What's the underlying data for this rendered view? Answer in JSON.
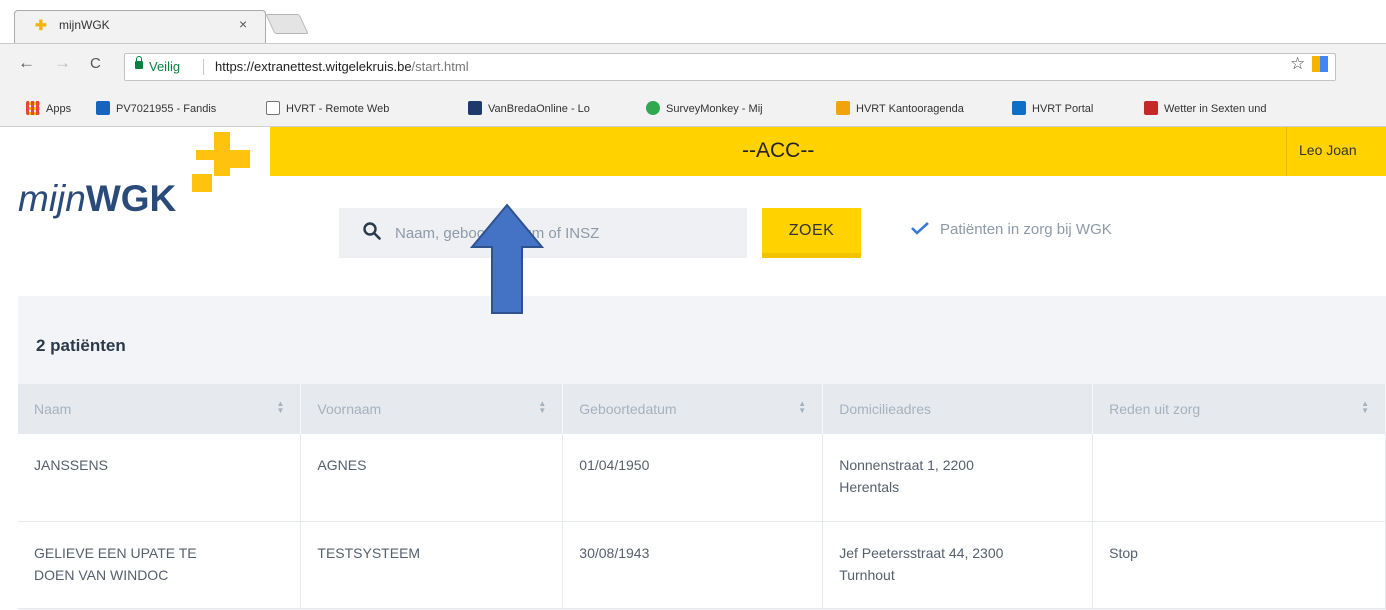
{
  "browser": {
    "tab": {
      "title": "mijnWGK",
      "close": "×"
    },
    "toolbar": {
      "back": "←",
      "forward": "→",
      "reload": "C",
      "bookmark_star": "☆"
    },
    "address": {
      "secure_label": "Veilig",
      "url_main": "https://extranettest.witgelekruis.be",
      "url_rest": "/start.html"
    },
    "bookmarks": [
      {
        "label": "Apps",
        "icon": "apps-grid-icon",
        "color": "#e8453c"
      },
      {
        "label": "PV7021955 - Fandis",
        "icon": "fandis-icon",
        "color": "#1565c0"
      },
      {
        "label": "HVRT - Remote Web",
        "icon": "page-icon",
        "color": "#ffffff"
      },
      {
        "label": "VanBredaOnline - Lo",
        "icon": "vanbreda-icon",
        "color": "#1e3a6b"
      },
      {
        "label": "SurveyMonkey - Mij",
        "icon": "surveymonkey-icon",
        "color": "#2fa84f"
      },
      {
        "label": "HVRT Kantooragenda",
        "icon": "outlook-icon",
        "color": "#f0a30a"
      },
      {
        "label": "HVRT Portal",
        "icon": "sharepoint-icon",
        "color": "#0f6fc6"
      },
      {
        "label": "Wetter in Sexten und",
        "icon": "cp-icon",
        "color": "#c62828"
      }
    ]
  },
  "header": {
    "env_label": "--ACC--",
    "user_name": "Leo Joan",
    "brand_color": "#ffd200"
  },
  "logo": {
    "light": "mijn",
    "bold": "WGK"
  },
  "search": {
    "placeholder": "Naam, geboortedatum of INSZ",
    "button_label": "ZOEK",
    "filter_label": "Patiënten in zorg bij WGK",
    "filter_checked": true
  },
  "results": {
    "count_label": "2 patiënten",
    "columns": [
      "Naam",
      "Voornaam",
      "Geboortedatum",
      "Domicilieadres",
      "Reden uit zorg"
    ],
    "rows": [
      {
        "naam": "JANSSENS",
        "voornaam": "AGNES",
        "geboortedatum": "01/04/1950",
        "adres": "Nonnenstraat 1, 2200 Herentals",
        "reden": ""
      },
      {
        "naam": "GELIEVE EEN UPATE TE DOEN VAN WINDOC",
        "voornaam": "TESTSYSTEEM",
        "geboortedatum": "30/08/1943",
        "adres": "Jef Peetersstraat 44, 2300 Turnhout",
        "reden": "Stop"
      }
    ]
  }
}
